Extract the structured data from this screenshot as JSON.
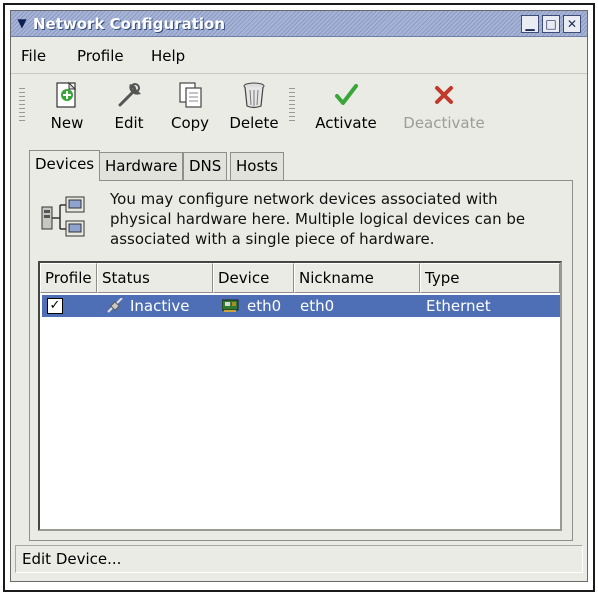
{
  "window": {
    "title": "Network Configuration",
    "controls": {
      "minimize": "▁",
      "maximize": "□",
      "close": "✕"
    }
  },
  "menubar": {
    "items": [
      {
        "label": "File",
        "mnemonic": "F"
      },
      {
        "label": "Profile",
        "mnemonic": "P"
      },
      {
        "label": "Help",
        "mnemonic": "H"
      }
    ]
  },
  "toolbar": {
    "new_label": "New",
    "edit_label": "Edit",
    "copy_label": "Copy",
    "delete_label": "Delete",
    "activate_label": "Activate",
    "deactivate_label": "Deactivate"
  },
  "tabs": {
    "devices": "Devices",
    "hardware": "Hardware",
    "dns": "DNS",
    "hosts": "Hosts"
  },
  "panel": {
    "info_line1": "You may configure network devices associated with",
    "info_line2": "physical hardware here.  Multiple logical devices can be",
    "info_line3": "associated with a single piece of hardware."
  },
  "table": {
    "columns": [
      "Profile",
      "Status",
      "Device",
      "Nickname",
      "Type"
    ],
    "rows": [
      {
        "profile_checked": "✓",
        "status": "Inactive",
        "device": "eth0",
        "nickname": "eth0",
        "type": "Ethernet"
      }
    ]
  },
  "statusbar": {
    "text": "Edit Device..."
  },
  "colors": {
    "selection": "#4e6fb5",
    "titlebar": "#a7b4d6",
    "activate_icon": "#3aa63a",
    "deactivate_icon": "#c0392b"
  }
}
